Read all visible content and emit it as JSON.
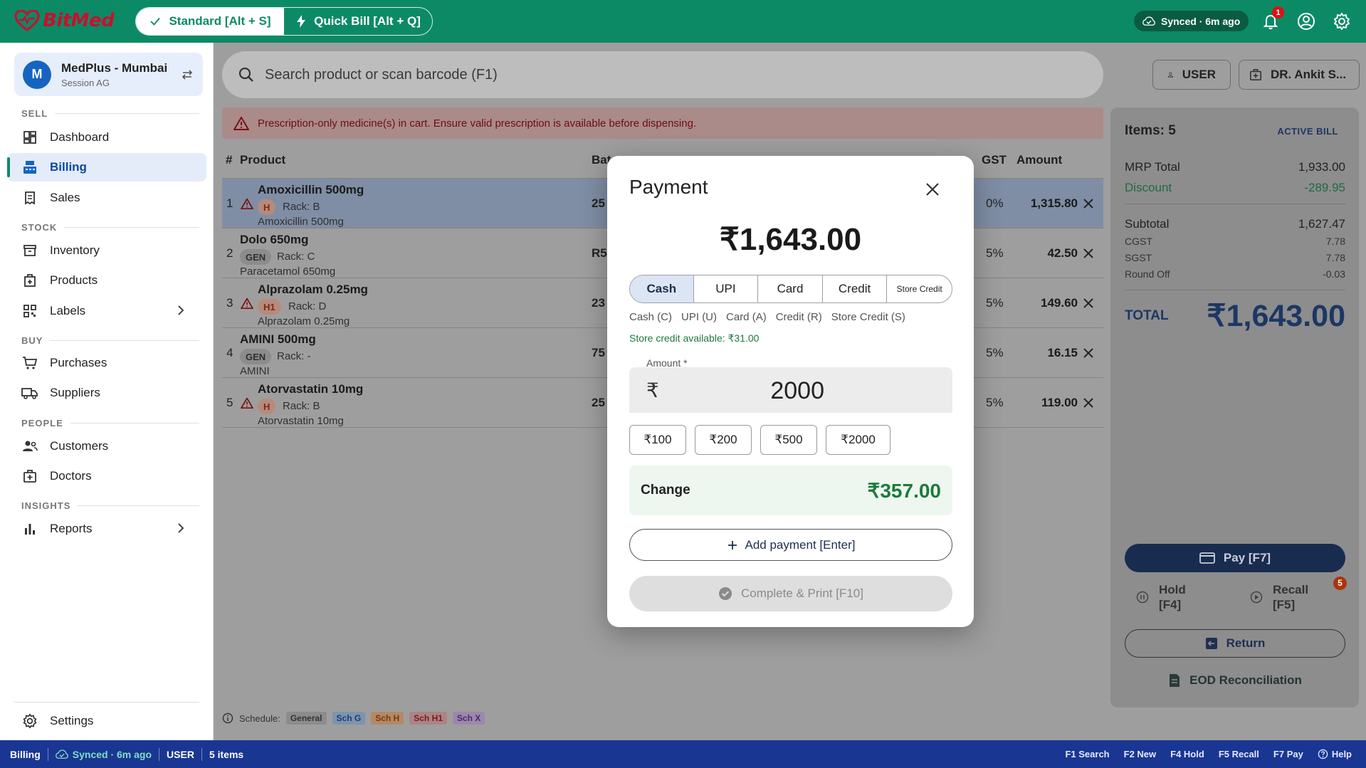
{
  "app": {
    "name": "BitMed"
  },
  "header": {
    "modes": [
      {
        "label": "Standard [Alt + S]",
        "active": true
      },
      {
        "label": "Quick Bill [Alt + Q]",
        "active": false
      }
    ],
    "sync_status": "Synced · 6m ago",
    "notifications_count": "1"
  },
  "sidebar": {
    "store": {
      "initial": "M",
      "name": "MedPlus - Mumbai",
      "session": "Session AG"
    },
    "sections": {
      "sell": "SELL",
      "stock": "STOCK",
      "buy": "BUY",
      "people": "PEOPLE",
      "insights": "INSIGHTS"
    },
    "items": {
      "dashboard": "Dashboard",
      "billing": "Billing",
      "sales": "Sales",
      "inventory": "Inventory",
      "products": "Products",
      "labels": "Labels",
      "purchases": "Purchases",
      "suppliers": "Suppliers",
      "customers": "Customers",
      "doctors": "Doctors",
      "reports": "Reports",
      "settings": "Settings"
    }
  },
  "search": {
    "placeholder": "Search product or scan barcode (F1)"
  },
  "user_button": "USER",
  "doctor_button": "DR. Ankit S...",
  "alert": "Prescription-only medicine(s) in cart. Ensure valid prescription is available before dispensing.",
  "table": {
    "headers": {
      "num": "#",
      "product": "Product",
      "batch": "Bat",
      "gst": "GST",
      "amount": "Amount"
    },
    "rows": [
      {
        "num": "1",
        "name": "Amoxicillin 500mg",
        "schedule": "H",
        "rack": "Rack: B",
        "generic": "Amoxicillin 500mg",
        "batch": "25",
        "gst": "0%",
        "amount": "1,315.80"
      },
      {
        "num": "2",
        "name": "Dolo 650mg",
        "schedule": "GEN",
        "rack": "Rack: C",
        "generic": "Paracetamol 650mg",
        "batch": "R5",
        "gst": "5%",
        "amount": "42.50"
      },
      {
        "num": "3",
        "name": "Alprazolam 0.25mg",
        "schedule": "H1",
        "rack": "Rack: D",
        "generic": "Alprazolam 0.25mg",
        "batch": "23",
        "gst": "5%",
        "amount": "149.60"
      },
      {
        "num": "4",
        "name": "AMINI 500mg",
        "schedule": "GEN",
        "rack": "Rack: -",
        "generic": "AMINI",
        "batch": "75",
        "gst": "5%",
        "amount": "16.15"
      },
      {
        "num": "5",
        "name": "Atorvastatin 10mg",
        "schedule": "H",
        "rack": "Rack: B",
        "generic": "Atorvastatin 10mg",
        "batch": "25",
        "gst": "5%",
        "amount": "119.00"
      }
    ]
  },
  "schedule_legend": {
    "label": "Schedule:",
    "items": [
      "General",
      "Sch G",
      "Sch H",
      "Sch H1",
      "Sch X"
    ]
  },
  "summary": {
    "items_label": "Items: 5",
    "active_bill": "ACTIVE BILL",
    "mrp_total_label": "MRP Total",
    "mrp_total": "1,933.00",
    "discount_label": "Discount",
    "discount": "-289.95",
    "subtotal_label": "Subtotal",
    "subtotal": "1,627.47",
    "cgst_label": "CGST",
    "cgst": "7.78",
    "sgst_label": "SGST",
    "sgst": "7.78",
    "roundoff_label": "Round Off",
    "roundoff": "-0.03",
    "total_label": "TOTAL",
    "total": "₹1,643.00"
  },
  "actions": {
    "pay": "Pay  [F7]",
    "hold_line1": "Hold",
    "hold_line2": "[F4]",
    "recall_line1": "Recall",
    "recall_line2": "[F5]",
    "recall_count": "5",
    "return": "Return",
    "eod": "EOD Reconciliation"
  },
  "payment_modal": {
    "title": "Payment",
    "amount": "₹1,643.00",
    "tabs": [
      "Cash",
      "UPI",
      "Card",
      "Credit",
      "Store Credit"
    ],
    "active_tab": "Cash",
    "shortcuts": [
      "Cash (C)",
      "UPI (U)",
      "Card (A)",
      "Credit (R)",
      "Store Credit (S)"
    ],
    "store_credit": "Store credit available: ₹31.00",
    "amount_label": "Amount *",
    "currency": "₹",
    "amount_value": "2000",
    "quick_amounts": [
      "₹100",
      "₹200",
      "₹500",
      "₹2000"
    ],
    "change_label": "Change",
    "change_value": "₹357.00",
    "add_payment": "Add payment  [Enter]",
    "complete": "Complete & Print  [F10]"
  },
  "statusbar": {
    "page": "Billing",
    "sync": "Synced · 6m ago",
    "user": "USER",
    "items": "5 items",
    "shortcuts": [
      "F1 Search",
      "F2 New",
      "F4 Hold",
      "F5 Recall",
      "F7 Pay"
    ],
    "help": "Help"
  },
  "colors": {
    "brand_green": "#0c8a66",
    "brand_red": "#c8102e",
    "status_blue": "#1a3693",
    "accent_blue": "#1565c0"
  }
}
